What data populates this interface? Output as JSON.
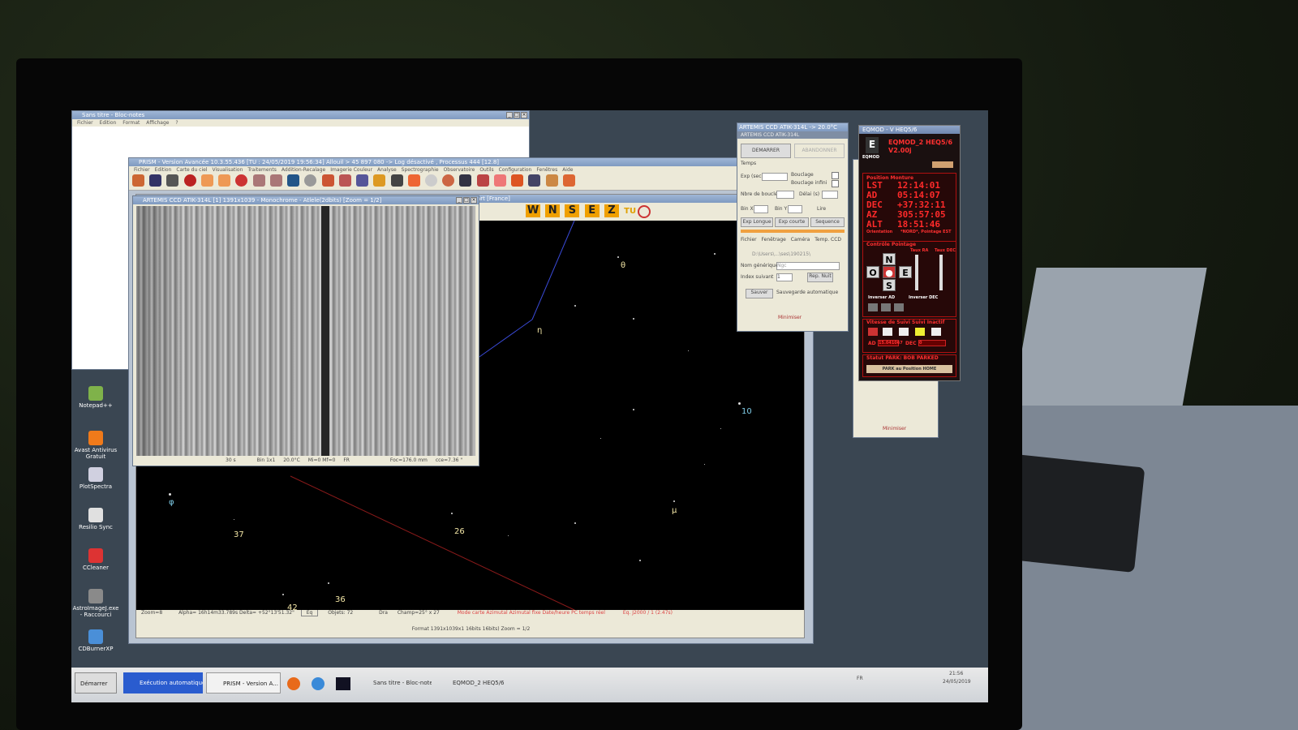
{
  "notepad": {
    "title": "Sans titre - Bloc-notes",
    "menu": [
      "Fichier",
      "Edition",
      "Format",
      "Affichage",
      "?"
    ]
  },
  "prism": {
    "title": "PRISM - Version Avancée 10.3.55.436   [TU : 24/05/2019 19:56:34]  Allouil > 45 897 080 -> Log désactivé , Processus 444 [12.8]",
    "menu": [
      "Fichier",
      "Edition",
      "Carte du ciel",
      "Visualisation",
      "Traitements",
      "Addition-Recalage",
      "Imagerie Couleur",
      "Analyse",
      "Spectrographie",
      "Observatoire",
      "Outils",
      "Configuration",
      "Fenêtres",
      "Aide"
    ]
  },
  "ccd_window": {
    "title": "ARTEMIS CCD ATIK-314L  [1]  1391x1039 - Monochrome - Atlele(2dbits)  [Zoom = 1/2]",
    "status": [
      "30 s",
      "Bin 1x1",
      "20.0°C",
      "Mi=0 Mf=0",
      "FR",
      "Foc=176.0 mm",
      "cce=7.36 \""
    ]
  },
  "map": {
    "title_tail": "art [France]",
    "nav": [
      "W",
      "N",
      "S",
      "E",
      "Z"
    ],
    "tu_label": "TU",
    "star_labels": [
      "θ",
      "η",
      "10",
      "μ",
      "φ",
      "37",
      "26",
      "36",
      "42"
    ],
    "status_zoom": "Zoom=8",
    "status_coords": "Alpha= 16h14m33.789s Delta= +52°13'51.32\"",
    "status_eq": "Eq",
    "status_objets": "Objets: 72",
    "status_dra": "Dra",
    "status_champ": "Champ=25° x 27",
    "status_mode": "Mode carte Azimutal Azimutal fixe  Date/heure PC temps réel",
    "status_epoch": "Eq. J2000 / 1 (2.47s)",
    "format_line": "Format 1391x1039x1 16bits 16bits)  Zoom = 1/2"
  },
  "artemis_ctrl": {
    "title": "ARTEMIS CCD ATIK-314L  -> 20.0°C",
    "subtitle": "ARTEMIS CCD ATIK-314L",
    "start_label": "DEMARRER",
    "abort_label": "ABANDONNER",
    "temps_label": "Temps",
    "exp_label": "Exp (sec)",
    "boucle_label": "Bouclage",
    "boucle_infini": "Bouclage infini",
    "nbre_boucle": "Nbre de boucle",
    "delai_label": "Délai (s)",
    "binx": "Bin X",
    "biny": "Bin Y",
    "lire_label": "Lire",
    "btn_exp_longue": "Exp Longue",
    "btn_exp_courte": "Exp courte",
    "btn_sequence": "Sequence",
    "tabs": [
      "Fichier",
      "Fenêtrage",
      "Caméra",
      "Temp. CCD"
    ],
    "path": "D:\\Users\\...\\ses\\190215\\",
    "nom_label": "Nom générique",
    "nom_value": "Ngc",
    "index_label": "Index suivant",
    "index_value": "1",
    "rep_btn": "Rep. Nuit",
    "sauver_label": "Sauver",
    "sauvegarde_auto": "Sauvegarde automatique",
    "minimiser": "Minimiser"
  },
  "eqmod": {
    "title": "EQMOD - V HEQ5/6",
    "logo_text": "EQMOD",
    "mount": "EQMOD_2 HEQ5/6",
    "version": "V2.00j",
    "panel_title": "Position Monture",
    "rows": [
      {
        "k": "LST",
        "v": "12:14:01"
      },
      {
        "k": "AD",
        "v": "05:14:07"
      },
      {
        "k": "DEC",
        "v": "+37:32:11"
      },
      {
        "k": "AZ",
        "v": "305:57:05"
      },
      {
        "k": "ALT",
        "v": "18:51:46"
      }
    ],
    "orientation_label": "Orientation",
    "orientation_value": "*NORD*, Pointage EST",
    "pointing_title": "Contrôle Pointage",
    "taux_ad": "Taux RA",
    "taux_dec": "Taux DEC",
    "dir_n": "N",
    "dir_o": "O",
    "dir_e": "E",
    "dir_s": "S",
    "inverser_ad": "Inverser AD",
    "inverser_dec": "Inverser DEC",
    "speed_title": "Vitesse de Suivi Suivi Inactif",
    "ad_label": "AD",
    "ad_rate": "15.041067",
    "dec_label": "DEC",
    "dec_rate": "0",
    "park_status": "Statut PARK: BOB PARKED",
    "park_button": "PARK au Position HOME",
    "minimiser": "Minimiser"
  },
  "desktop_icons": [
    {
      "label": "Notepad++",
      "color": "#7fb24a"
    },
    {
      "label": "Avast Antivirus Gratuit",
      "color": "#f07a1a"
    },
    {
      "label": "PlotSpectra",
      "color": "#d0d0e0"
    },
    {
      "label": "Resilio Sync",
      "color": "#e0e0e0"
    },
    {
      "label": "CCleaner",
      "color": "#d33"
    },
    {
      "label": "AstroImageJ.exe - Raccourci",
      "color": "#8a8a8a"
    },
    {
      "label": "CDBurnerXP",
      "color": "#4a8fd8"
    }
  ],
  "taskbar": {
    "start": "Démarrer",
    "items": [
      "Exécution automatique",
      "PRISM - Version A...",
      "Sans titre - Bloc-notes",
      "EQMOD_2 HEQ5/6"
    ],
    "lang": "FR",
    "clock": "21:56",
    "date": "24/05/2019"
  }
}
